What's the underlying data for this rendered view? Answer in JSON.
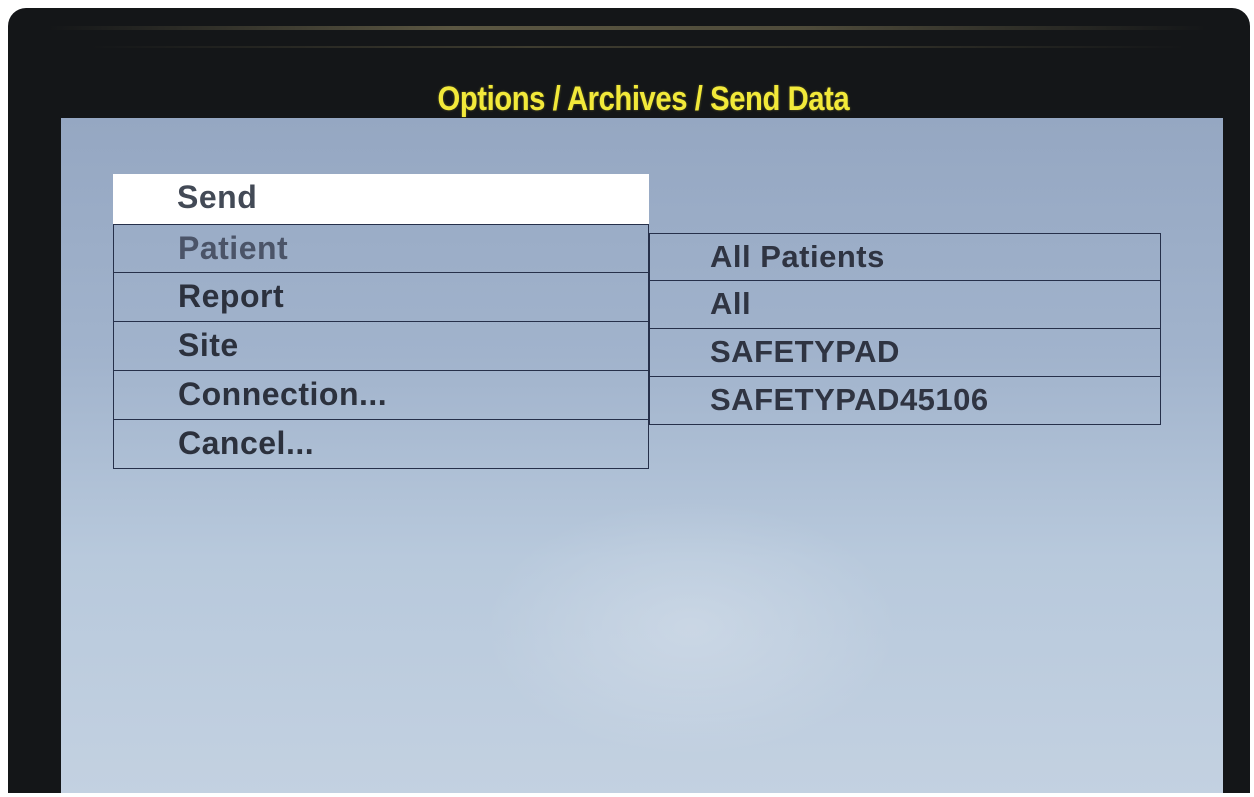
{
  "header": {
    "title": "Options / Archives / Send Data"
  },
  "menu": {
    "items": [
      {
        "label": "Send",
        "selected": true
      },
      {
        "label": "Patient"
      },
      {
        "label": "Report"
      },
      {
        "label": "Site"
      },
      {
        "label": "Connection..."
      },
      {
        "label": "Cancel..."
      }
    ]
  },
  "values": {
    "patient": "All Patients",
    "report": "All",
    "site": "SAFETYPAD",
    "connection": "SAFETYPAD45106"
  },
  "colors": {
    "title": "#f2e93a",
    "screen_background": "#a1b3cc",
    "selection": "#ffffff",
    "bezel": "#141618"
  }
}
